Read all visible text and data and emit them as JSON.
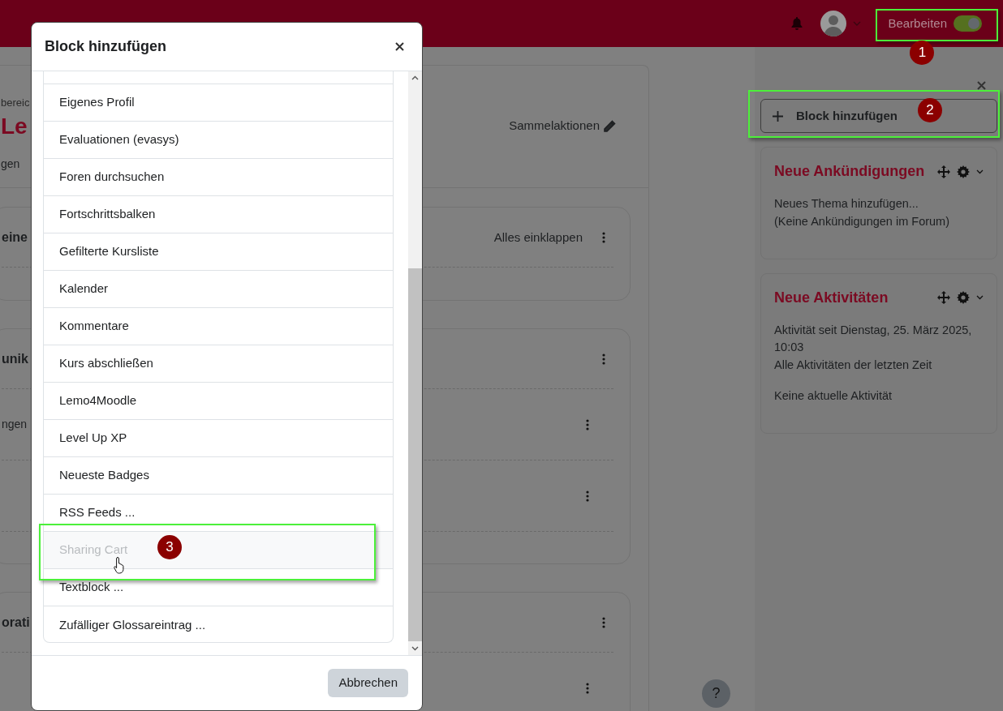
{
  "navbar": {
    "edit_mode": {
      "label": "Bearbeiten",
      "on": true,
      "callout": "1"
    }
  },
  "course": {
    "breadcrumb": "bereic",
    "title": "Le",
    "secondary_nav": "gen",
    "bulk_edit": "Sammelaktionen",
    "sections": [
      {
        "title": "eine",
        "collapse_all": "Alles einklappen"
      },
      {
        "title": "unik",
        "activities": [
          {
            "kind": "labelled",
            "label": "ngen"
          },
          {
            "kind": "blank"
          }
        ]
      },
      {
        "title": "orati",
        "activities": [
          {
            "kind": "blank"
          }
        ]
      }
    ]
  },
  "drawer": {
    "add_block": {
      "label": "Block hinzufügen",
      "callout": "2"
    },
    "blocks": [
      {
        "title": "Neue Ankündigungen",
        "paragraphs": [
          [
            "Neues Thema hinzufügen...",
            "(Keine Ankündigungen im Forum)"
          ]
        ]
      },
      {
        "title": "Neue Aktivitäten",
        "paragraphs": [
          [
            "Aktivität seit Dienstag, 25. März 2025, 10:03",
            "Alle Aktivitäten der letzten Zeit"
          ],
          [
            "Keine aktuelle Aktivität"
          ]
        ]
      }
    ]
  },
  "help_button": "?",
  "modal": {
    "title": "Block hinzufügen",
    "items": [
      {
        "label": "Eigenes Profil",
        "hovered": false
      },
      {
        "label": "Evaluationen (evasys)",
        "hovered": false
      },
      {
        "label": "Foren durchsuchen",
        "hovered": false
      },
      {
        "label": "Fortschrittsbalken",
        "hovered": false
      },
      {
        "label": "Gefilterte Kursliste",
        "hovered": false
      },
      {
        "label": "Kalender",
        "hovered": false
      },
      {
        "label": "Kommentare",
        "hovered": false
      },
      {
        "label": "Kurs abschließen",
        "hovered": false
      },
      {
        "label": "Lemo4Moodle",
        "hovered": false
      },
      {
        "label": "Level Up XP",
        "hovered": false
      },
      {
        "label": "Neueste Badges",
        "hovered": false
      },
      {
        "label": "RSS Feeds ...",
        "hovered": false
      },
      {
        "label": "Sharing Cart",
        "hovered": true,
        "callout": "3"
      },
      {
        "label": "Textblock ...",
        "hovered": false
      },
      {
        "label": "Zufälliger Glossareintrag ...",
        "hovered": false
      }
    ],
    "cancel": "Abbrechen"
  }
}
